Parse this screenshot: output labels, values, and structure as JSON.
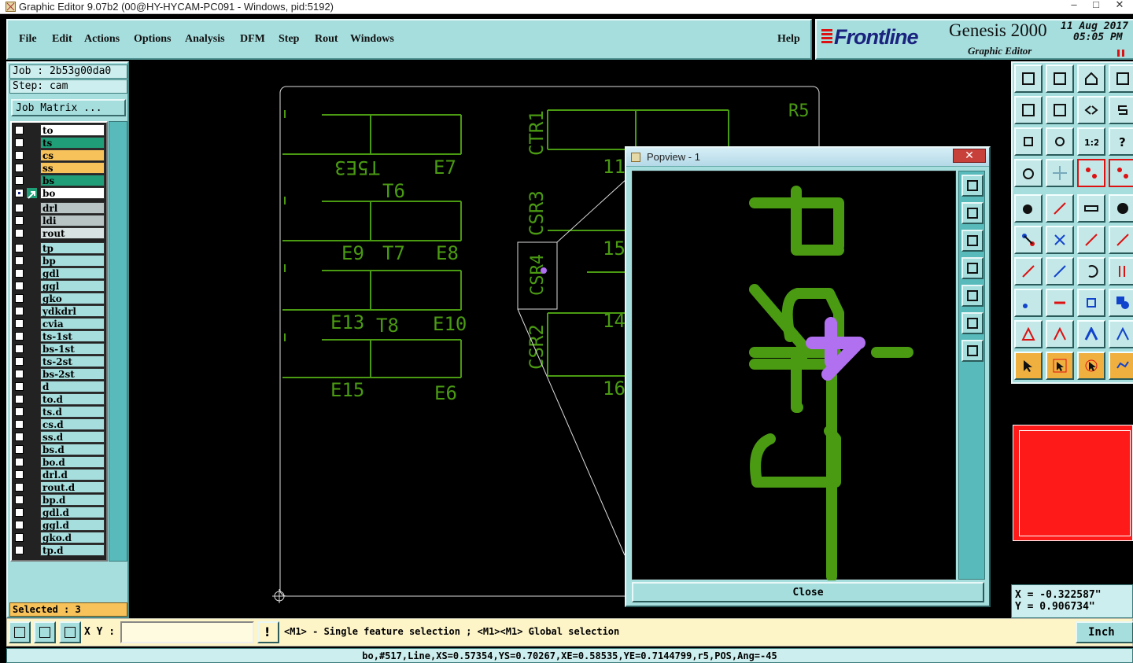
{
  "window": {
    "title": "Graphic Editor 9.07b2 (00@HY-HYCAM-PC091 - Windows, pid:5192)"
  },
  "menu": {
    "items": [
      "File",
      "Edit",
      "Actions",
      "Options",
      "Analysis",
      "DFM",
      "Step",
      "Rout",
      "Windows"
    ],
    "help": "Help"
  },
  "brand": {
    "logo": "Frontline",
    "product": "Genesis 2000",
    "subtitle": "Graphic Editor",
    "date": "11 Aug 2017",
    "time": "05:05 PM"
  },
  "job": {
    "job_label": "Job : 2b53g00da0",
    "step_label": "Step: cam",
    "matrix_button": "Job Matrix ..."
  },
  "layers": [
    {
      "name": "to",
      "color": "#ffffff",
      "checked": false
    },
    {
      "name": "ts",
      "color": "#1f9e78",
      "checked": false
    },
    {
      "name": "cs",
      "color": "#f7c25a",
      "checked": false
    },
    {
      "name": "ss",
      "color": "#f7c25a",
      "checked": false
    },
    {
      "name": "bs",
      "color": "#1f9e78",
      "checked": false
    },
    {
      "name": "bo",
      "color": "#ffffff",
      "checked": true,
      "active": true
    },
    {
      "name": "drl",
      "color": "#b8c4c4",
      "checked": false
    },
    {
      "name": "ldi",
      "color": "#b8c4c4",
      "checked": false
    },
    {
      "name": "rout",
      "color": "#d9e2e2",
      "checked": false
    },
    {
      "name": "tp",
      "color": "#a6dede",
      "checked": false
    },
    {
      "name": "bp",
      "color": "#a6dede",
      "checked": false
    },
    {
      "name": "gdl",
      "color": "#a6dede",
      "checked": false
    },
    {
      "name": "ggl",
      "color": "#a6dede",
      "checked": false
    },
    {
      "name": "gko",
      "color": "#a6dede",
      "checked": false
    },
    {
      "name": "ydkdrl",
      "color": "#a6dede",
      "checked": false
    },
    {
      "name": "cvia",
      "color": "#a6dede",
      "checked": false
    },
    {
      "name": "ts-1st",
      "color": "#a6dede",
      "checked": false
    },
    {
      "name": "bs-1st",
      "color": "#a6dede",
      "checked": false
    },
    {
      "name": "ts-2st",
      "color": "#a6dede",
      "checked": false
    },
    {
      "name": "bs-2st",
      "color": "#a6dede",
      "checked": false
    },
    {
      "name": "d",
      "color": "#a6dede",
      "checked": false
    },
    {
      "name": "to.d",
      "color": "#a6dede",
      "checked": false
    },
    {
      "name": "ts.d",
      "color": "#a6dede",
      "checked": false
    },
    {
      "name": "cs.d",
      "color": "#a6dede",
      "checked": false
    },
    {
      "name": "ss.d",
      "color": "#a6dede",
      "checked": false
    },
    {
      "name": "bs.d",
      "color": "#a6dede",
      "checked": false
    },
    {
      "name": "bo.d",
      "color": "#a6dede",
      "checked": false
    },
    {
      "name": "drl.d",
      "color": "#a6dede",
      "checked": false
    },
    {
      "name": "rout.d",
      "color": "#a6dede",
      "checked": false
    },
    {
      "name": "bp.d",
      "color": "#a6dede",
      "checked": false
    },
    {
      "name": "gdl.d",
      "color": "#a6dede",
      "checked": false
    },
    {
      "name": "ggl.d",
      "color": "#a6dede",
      "checked": false
    },
    {
      "name": "gko.d",
      "color": "#a6dede",
      "checked": false
    },
    {
      "name": "tp.d",
      "color": "#a6dede",
      "checked": false
    }
  ],
  "selected": "Selected : 3",
  "canvas": {
    "labels": [
      "T5E3",
      "E7",
      "T6",
      "E9",
      "T7",
      "E8",
      "E13",
      "T8",
      "E10",
      "E15",
      "E6",
      "CTR1",
      "CSR3",
      "CSR4",
      "CSR2",
      "R5",
      "11",
      "14",
      "16",
      "15"
    ]
  },
  "popview": {
    "title": "Popview - 1",
    "close_label": "Close"
  },
  "coords": {
    "x": "X = -0.322587\"",
    "y": "Y = 0.906734\""
  },
  "bottom": {
    "xy_label": "X Y :",
    "xy_value": "",
    "hint": "<M1> - Single feature selection ; <M1><M1> Global selection",
    "units": "Inch"
  },
  "status": "bo,#517,Line,XS=0.57354,YS=0.70267,XE=0.58535,YE=0.7144799,r5,POS,Ang=-45",
  "colors": {
    "panel": "#a6dede",
    "feature": "#4a9a12",
    "highlight": "#b070f0"
  }
}
